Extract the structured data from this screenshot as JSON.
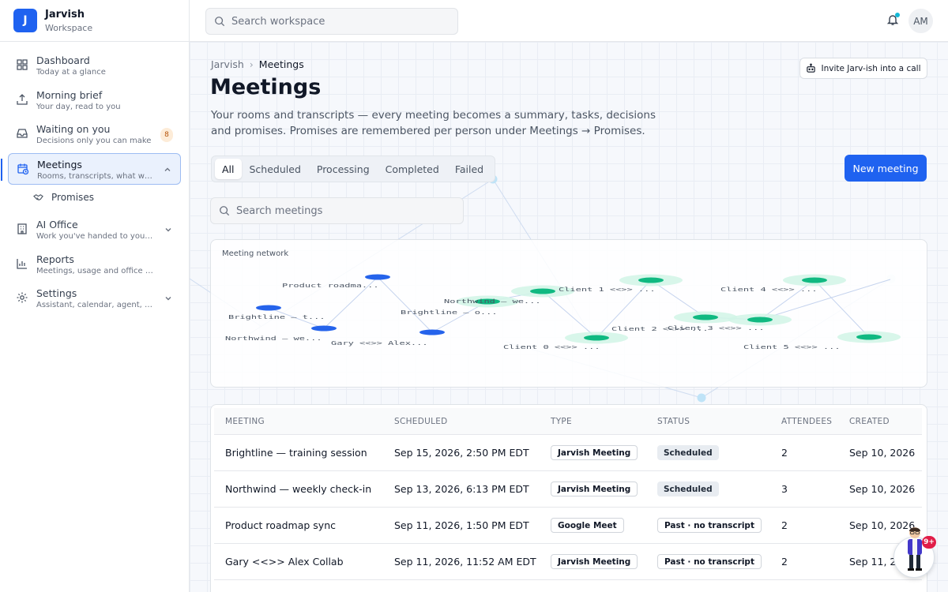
{
  "brand": {
    "initial": "J",
    "name": "Jarvish",
    "subtitle": "Workspace"
  },
  "search": {
    "placeholder": "Search workspace"
  },
  "user": {
    "initials": "AM"
  },
  "sidebar": {
    "items": [
      {
        "title": "Dashboard",
        "desc": "Today at a glance",
        "icon": "grid-icon"
      },
      {
        "title": "Morning brief",
        "desc": "Your day, read to you",
        "icon": "upload-tray-icon"
      },
      {
        "title": "Waiting on you",
        "desc": "Decisions only you can make",
        "icon": "inbox-icon",
        "badge": "8"
      },
      {
        "title": "Meetings",
        "desc": "Rooms, transcripts, what was decided",
        "icon": "calendar-clock-icon",
        "active": true
      },
      {
        "title": "AI Office",
        "desc": "Work you've handed to your agents",
        "icon": "building-icon"
      },
      {
        "title": "Reports",
        "desc": "Meetings, usage and office activity",
        "icon": "bar-chart-icon"
      },
      {
        "title": "Settings",
        "desc": "Assistant, calendar, agent, billing",
        "icon": "gear-icon"
      }
    ],
    "sub_items": [
      {
        "label": "Promises",
        "icon": "handshake-icon"
      }
    ]
  },
  "breadcrumb": {
    "root": "Jarvish",
    "separator": "›",
    "current": "Meetings"
  },
  "header": {
    "title": "Meetings",
    "description": "Your rooms and transcripts — every meeting becomes a summary, tasks, decisions and promises. Promises are remembered per person under Meetings → Promises.",
    "invite_label": "Invite Jarv-ish into a call",
    "new_meeting_label": "New meeting"
  },
  "tabs": [
    {
      "label": "All",
      "active": true
    },
    {
      "label": "Scheduled"
    },
    {
      "label": "Processing"
    },
    {
      "label": "Completed"
    },
    {
      "label": "Failed"
    }
  ],
  "meeting_search": {
    "placeholder": "Search meetings"
  },
  "network": {
    "title": "Meeting network",
    "nodes": [
      {
        "label": "Product roadma...",
        "color": "#2563eb"
      },
      {
        "label": "Brightline — t...",
        "color": "#2563eb"
      },
      {
        "label": "Northwind — we...",
        "color": "#2563eb"
      },
      {
        "label": "Gary <<>> Alex...",
        "color": "#2563eb"
      },
      {
        "label": "Northwind — we...",
        "color": "#10b981"
      },
      {
        "label": "Brightline — o...",
        "color": "#10b981"
      },
      {
        "label": "Client 1 <<>> ...",
        "color": "#10b981"
      },
      {
        "label": "Client 0 <<>> ...",
        "color": "#10b981"
      },
      {
        "label": "Client 4 <<>> ...",
        "color": "#10b981"
      },
      {
        "label": "Client 2 <<>> ...",
        "color": "#10b981"
      },
      {
        "label": "Client 3 <<>> ...",
        "color": "#10b981"
      },
      {
        "label": "Client 5 <<>> ...",
        "color": "#10b981"
      }
    ]
  },
  "table": {
    "columns": [
      "MEETING",
      "SCHEDULED",
      "TYPE",
      "STATUS",
      "ATTENDEES",
      "CREATED"
    ],
    "rows": [
      {
        "meeting": "Brightline — training session",
        "scheduled": "Sep 15, 2026, 2:50 PM EDT",
        "type": "Jarvish Meeting",
        "status": "Scheduled",
        "status_kind": "sched",
        "attendees": "2",
        "created": "Sep 10, 2026"
      },
      {
        "meeting": "Northwind — weekly check-in",
        "scheduled": "Sep 13, 2026, 6:13 PM EDT",
        "type": "Jarvish Meeting",
        "status": "Scheduled",
        "status_kind": "sched",
        "attendees": "3",
        "created": "Sep 10, 2026"
      },
      {
        "meeting": "Product roadmap sync",
        "scheduled": "Sep 11, 2026, 1:50 PM EDT",
        "type": "Google Meet",
        "status": "Past · no transcript",
        "status_kind": "past",
        "attendees": "2",
        "created": "Sep 10, 2026"
      },
      {
        "meeting": "Gary <<>> Alex Collab",
        "scheduled": "Sep 11, 2026, 11:52 AM EDT",
        "type": "Jarvish Meeting",
        "status": "Past · no transcript",
        "status_kind": "past",
        "attendees": "2",
        "created": "Sep 11, 2"
      }
    ]
  },
  "assistant": {
    "badge": "9+"
  },
  "colors": {
    "accent": "#1f62f0",
    "node_blue": "#2563eb",
    "node_green": "#10b981",
    "badge_red": "#e11d48"
  }
}
